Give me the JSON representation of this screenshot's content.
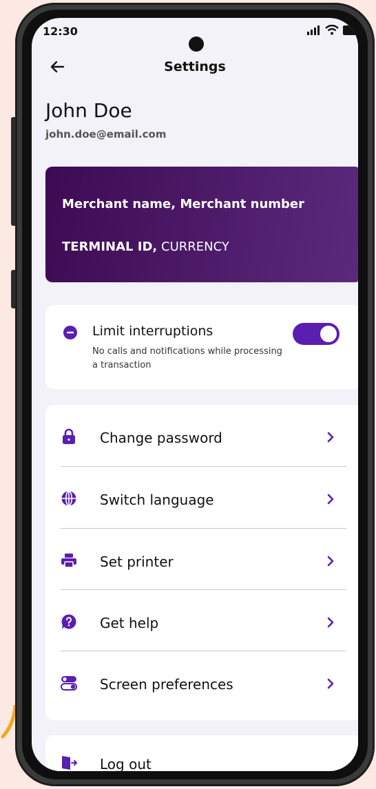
{
  "status_bar": {
    "time": "12:30"
  },
  "header": {
    "title": "Settings"
  },
  "user": {
    "name": "John Doe",
    "email": "john.doe@email.com"
  },
  "merchant_card": {
    "line1": "Merchant name, Merchant number",
    "terminal_label": "TERMINAL ID,",
    "currency_label": "CURRENCY"
  },
  "limit_interruptions": {
    "title": "Limit interruptions",
    "description": "No calls and notifications while processing a transaction",
    "enabled": true
  },
  "menu": {
    "items": [
      {
        "label": "Change password",
        "icon": "lock-icon"
      },
      {
        "label": "Switch language",
        "icon": "globe-icon"
      },
      {
        "label": "Set printer",
        "icon": "printer-icon"
      },
      {
        "label": "Get help",
        "icon": "help-icon"
      },
      {
        "label": "Screen preferences",
        "icon": "toggles-icon"
      }
    ]
  },
  "logout": {
    "label": "Log out",
    "icon": "logout-icon"
  },
  "colors": {
    "accent": "#5a1eb0",
    "card_gradient_start": "#3d0b52",
    "card_gradient_end": "#5b2a7d",
    "background": "#fde9e3"
  }
}
